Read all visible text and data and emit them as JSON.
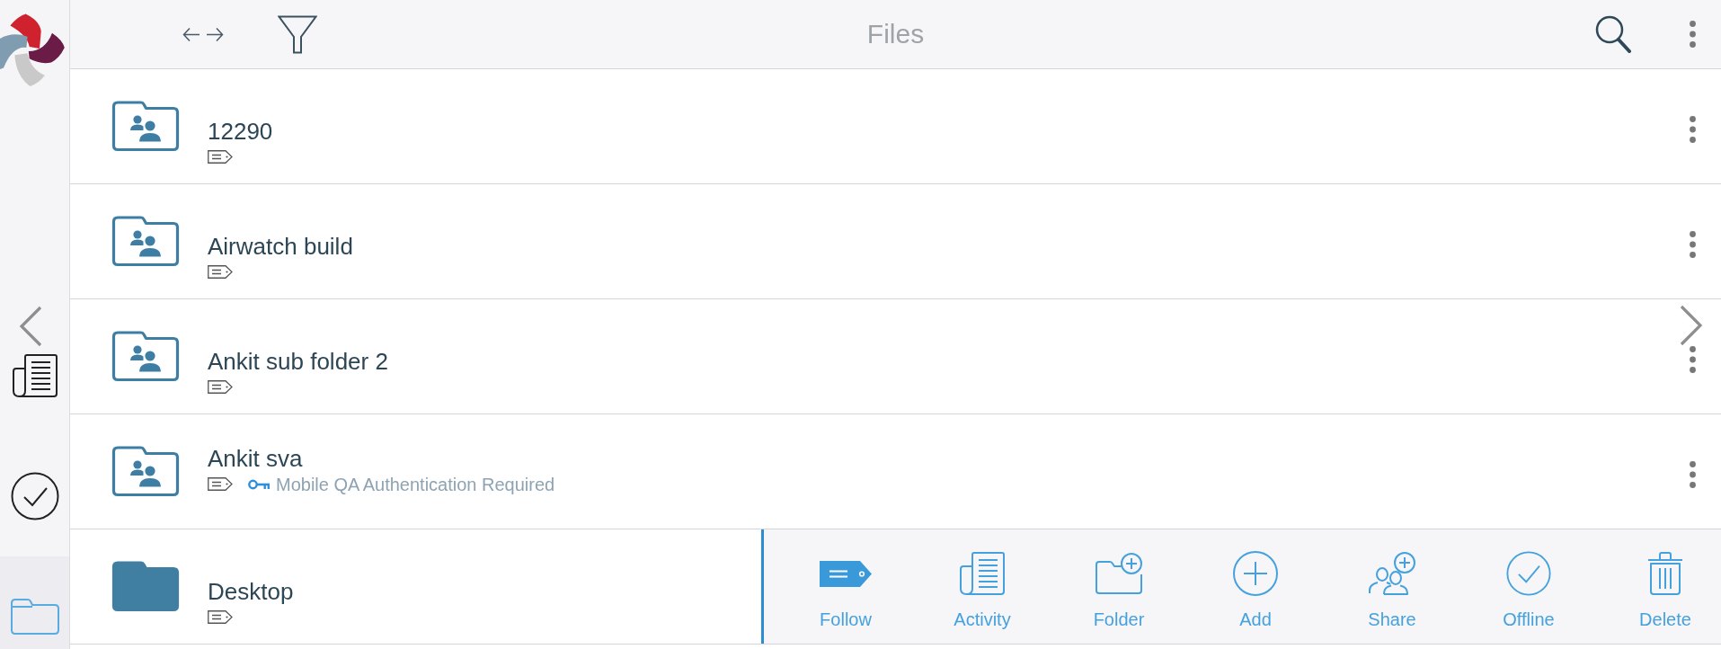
{
  "header": {
    "title": "Files"
  },
  "sidebar": {
    "items": [
      {
        "kind": "activity",
        "selected": false
      },
      {
        "kind": "tasks",
        "selected": false
      },
      {
        "kind": "files",
        "selected": true
      }
    ]
  },
  "rows": [
    {
      "name": "12290",
      "kind": "shared",
      "expanded": false
    },
    {
      "name": "Airwatch build",
      "kind": "shared",
      "expanded": false
    },
    {
      "name": "Ankit sub folder 2",
      "kind": "shared",
      "expanded": false
    },
    {
      "name": "Ankit sva",
      "kind": "shared",
      "expanded": false,
      "auth_note": "Mobile QA Authentication Required"
    },
    {
      "name": "Desktop",
      "kind": "folder",
      "expanded": true
    }
  ],
  "row_actions": [
    {
      "label": "Follow",
      "kind": "follow"
    },
    {
      "label": "Activity",
      "kind": "activity"
    },
    {
      "label": "Folder",
      "kind": "new_folder"
    },
    {
      "label": "Add",
      "kind": "add"
    },
    {
      "label": "Share",
      "kind": "share"
    },
    {
      "label": "Offline",
      "kind": "offline"
    },
    {
      "label": "Delete",
      "kind": "delete"
    }
  ]
}
